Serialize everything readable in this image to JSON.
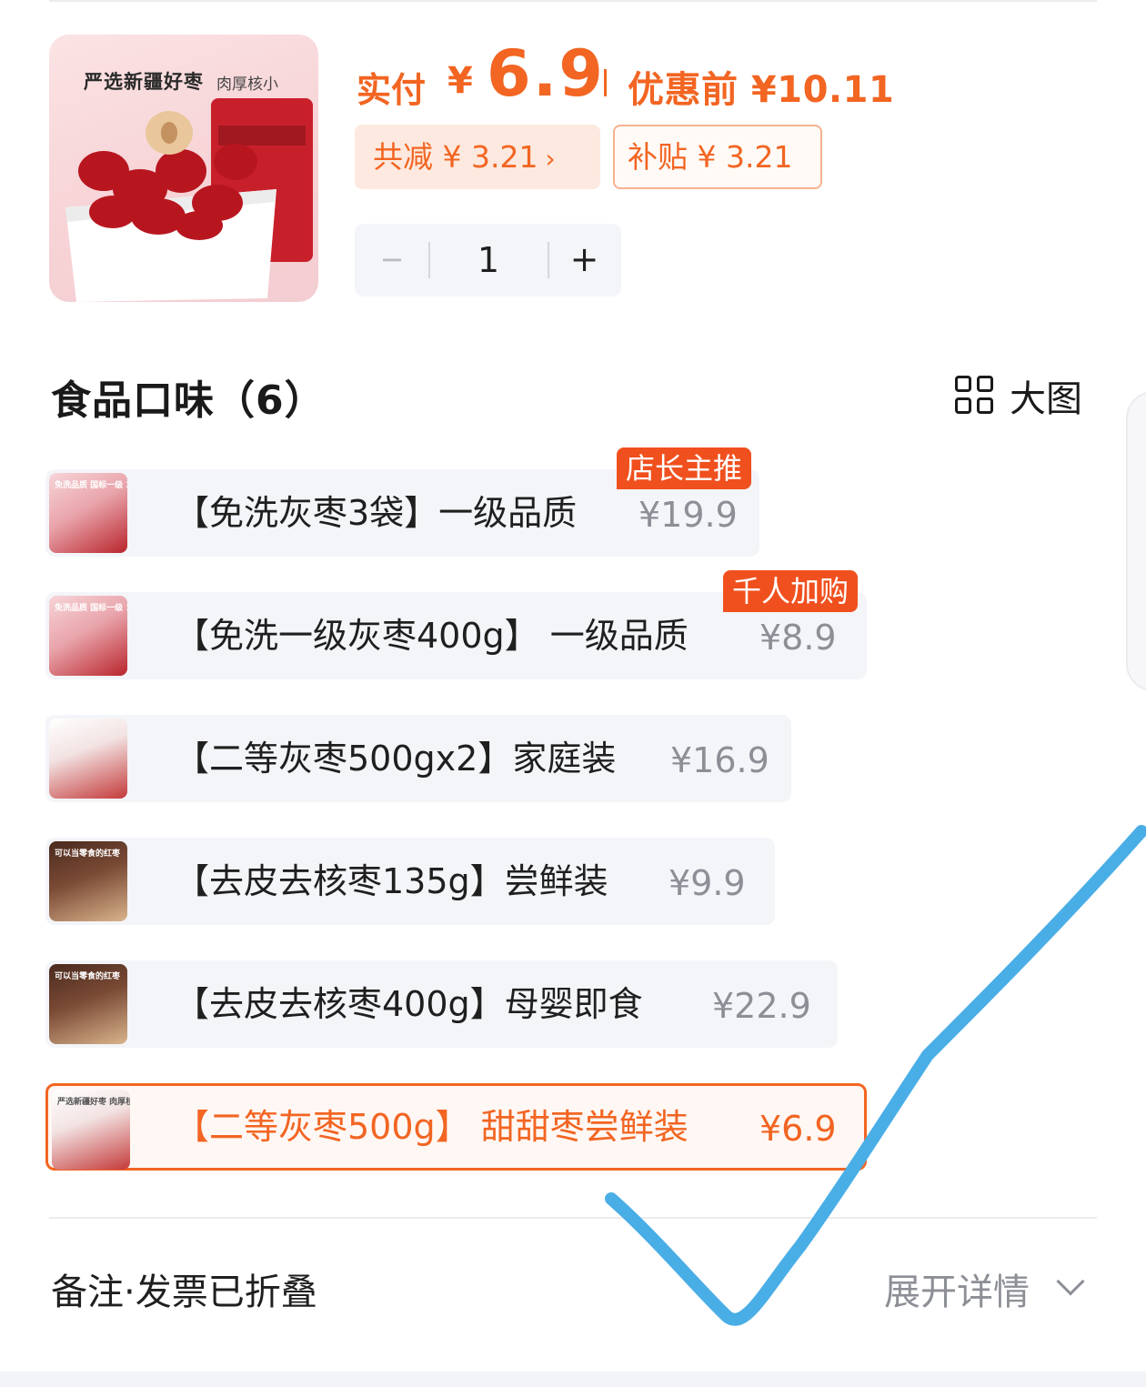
{
  "product": {
    "image_text_main": "严选新疆好枣",
    "image_text_sub": "肉厚核小",
    "pay_label": "实付",
    "pay_currency": "¥",
    "pay_amount": "6.9",
    "original_price": "优惠前 ¥10.11",
    "reduce_badge": "共减 ¥ 3.21",
    "subsidy_badge": "补贴 ¥ 3.21",
    "quantity": "1",
    "minus_symbol": "−",
    "plus_symbol": "+"
  },
  "section": {
    "title": "食品口味（6）",
    "view_toggle_label": "大图",
    "view_toggle_icon": "grid-icon"
  },
  "options": [
    {
      "name": "【免洗灰枣3袋】一级品质",
      "price": "¥19.9",
      "tag": "店长主推",
      "image_caption": "免洗品质 国标一级 3袋",
      "selected": false
    },
    {
      "name": "【免洗一级灰枣400g】 一级品质",
      "price": "¥8.9",
      "tag": "千人加购",
      "image_caption": "免洗品质 国标一级 1袋",
      "selected": false
    },
    {
      "name": "【二等灰枣500gx2】家庭装",
      "price": "¥16.9",
      "tag": "",
      "image_caption": "",
      "selected": false
    },
    {
      "name": "【去皮去核枣135g】尝鲜装",
      "price": "¥9.9",
      "tag": "",
      "image_caption": "可以当零食的红枣",
      "selected": false
    },
    {
      "name": "【去皮去核枣400g】母婴即食",
      "price": "¥22.9",
      "tag": "",
      "image_caption": "可以当零食的红枣",
      "selected": false
    },
    {
      "name": "【二等灰枣500g】 甜甜枣尝鲜装",
      "price": "¥6.9",
      "tag": "",
      "image_caption": "严选新疆好枣 肉厚核小",
      "selected": true
    }
  ],
  "footer": {
    "remark_label": "备注·发票已折叠",
    "expand_label": "展开详情",
    "expand_icon": "chevron-down-icon"
  },
  "colors": {
    "accent": "#f26522",
    "tag_bg": "#f0501e",
    "muted": "#8c8f96",
    "annotation_stroke": "#4aaee6"
  }
}
